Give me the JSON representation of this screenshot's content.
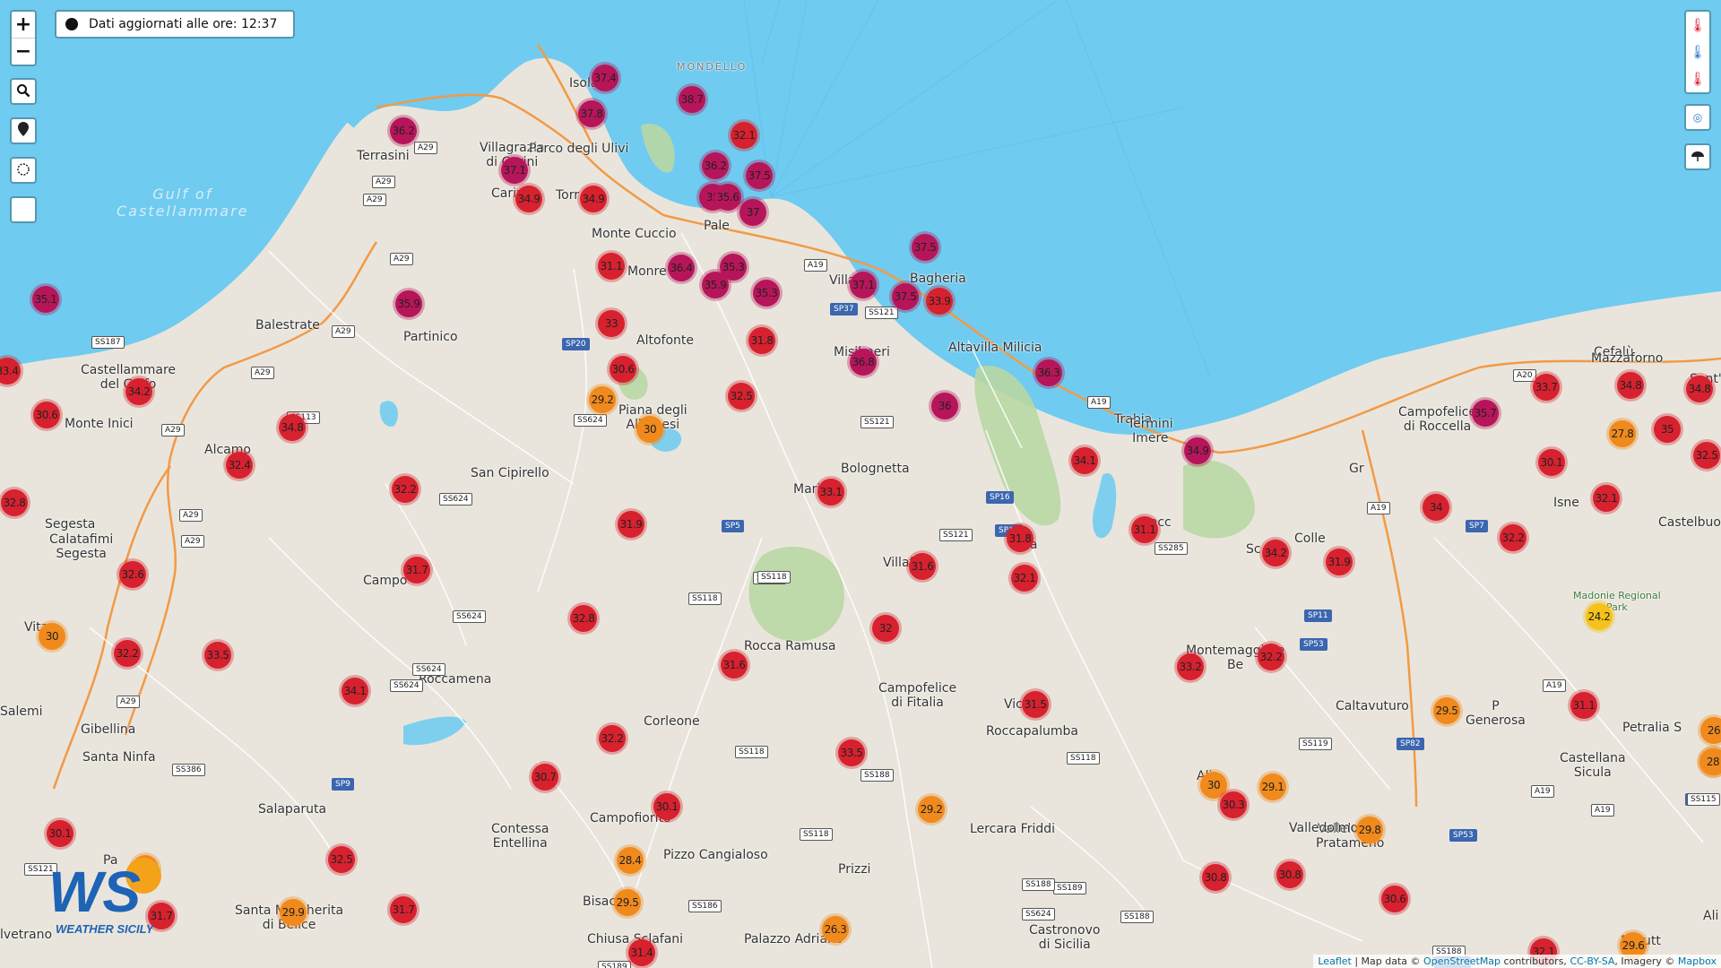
{
  "info_box": {
    "text": "Dati aggiornati alle ore: 12:37"
  },
  "controls": {
    "zoom_in": "+",
    "zoom_out": "−"
  },
  "colors": {
    "sea": "#6fcbf0",
    "land": "#e9e5dc",
    "highway": "#f29a46",
    "red": "#d7212e",
    "magenta": "#b7155a",
    "orange": "#f08a1c",
    "yellow": "#f4c21a"
  },
  "sea_labels": [
    {
      "name": "Gulf of\nCastellammare"
    }
  ],
  "places": [
    {
      "name": "MONDELLO"
    },
    {
      "name": "Terrasini"
    },
    {
      "name": "Villagrazia\ndi Carini"
    },
    {
      "name": "Parco degli Ulivi"
    },
    {
      "name": "Carini"
    },
    {
      "name": "Torr"
    },
    {
      "name": "Monte Cuccio"
    },
    {
      "name": "Pale"
    },
    {
      "name": "Monre"
    },
    {
      "name": "Isola"
    },
    {
      "name": "Villa"
    },
    {
      "name": "Bagheria"
    },
    {
      "name": "Altavilla Milicia"
    },
    {
      "name": "Misilmeri"
    },
    {
      "name": "Altofonte"
    },
    {
      "name": "Piana degli\nAlbanesi"
    },
    {
      "name": "Balestrate"
    },
    {
      "name": "Partinico"
    },
    {
      "name": "Castellammare\ndel Golfo"
    },
    {
      "name": "Monte Inici"
    },
    {
      "name": "Alcamo"
    },
    {
      "name": "San Cipirello"
    },
    {
      "name": "Bolognetta"
    },
    {
      "name": "Mari"
    },
    {
      "name": "Trabia"
    },
    {
      "name": "Termini\nImere"
    },
    {
      "name": "Campofelice\ndi Roccella"
    },
    {
      "name": "Cefalù"
    },
    {
      "name": "Mazzaforno"
    },
    {
      "name": "Sant'Ambrog"
    },
    {
      "name": "Segesta"
    },
    {
      "name": "Calatafimi\nSegesta"
    },
    {
      "name": "Campo"
    },
    {
      "name": "Villaf"
    },
    {
      "name": "Cacc"
    },
    {
      "name": "Sc"
    },
    {
      "name": "Isne"
    },
    {
      "name": "Colle"
    },
    {
      "name": "Castelbuon"
    },
    {
      "name": "Madonie Regional\nPark"
    },
    {
      "name": "Vita"
    },
    {
      "name": "Salemi"
    },
    {
      "name": "Roccamena"
    },
    {
      "name": "Rocca Ramusa"
    },
    {
      "name": "Corleone"
    },
    {
      "name": "Campofelice\ndi Fitalia"
    },
    {
      "name": "Vica"
    },
    {
      "name": "Roccapalumba"
    },
    {
      "name": "Montemaggiore\nBe"
    },
    {
      "name": "Caltavuturo"
    },
    {
      "name": "Petralia S"
    },
    {
      "name": "P\nGenerosa"
    },
    {
      "name": "Castellana\nSicula"
    },
    {
      "name": "Gibellina"
    },
    {
      "name": "Santa Ninfa"
    },
    {
      "name": "Salaparuta"
    },
    {
      "name": "Contessa\nEntellina"
    },
    {
      "name": "Campofiorito"
    },
    {
      "name": "Pizzo Cangialoso"
    },
    {
      "name": "Prizzi"
    },
    {
      "name": "Lercara Friddi"
    },
    {
      "name": "Alia"
    },
    {
      "name": "Vallelunga\nPratameno"
    },
    {
      "name": "Valledolmo"
    },
    {
      "name": "Pa"
    },
    {
      "name": "Santa Margherita\ndi Belice"
    },
    {
      "name": "lvetrano"
    },
    {
      "name": "Bisac"
    },
    {
      "name": "Chiusa Sclafani"
    },
    {
      "name": "Palazzo Adriano"
    },
    {
      "name": "Castronovo\ndi Sicilia"
    },
    {
      "name": "Resutt"
    },
    {
      "name": "Ali"
    },
    {
      "name": "Gr"
    },
    {
      "name": "Sa"
    }
  ],
  "roads": [
    "A29",
    "A29",
    "A29",
    "A29",
    "A29",
    "A29",
    "A29",
    "A29",
    "A29",
    "A29",
    "A19",
    "A19",
    "A19",
    "A19",
    "A19",
    "A19",
    "A20",
    "SS187",
    "SS113",
    "SP20",
    "SS624",
    "SS624",
    "SS624",
    "SS624",
    "SS624",
    "SS121",
    "SS121",
    "SS121",
    "SP37",
    "SP16",
    "SP16",
    "SS285",
    "SP5",
    "SS118",
    "SS118",
    "SS118",
    "SS118",
    "SS118",
    "SS118",
    "SS189",
    "SS188",
    "SS188",
    "SS189",
    "SS186",
    "SS386",
    "SS188",
    "SS119",
    "SP82",
    "SP53",
    "SP53",
    "SP7",
    "SP8",
    "SP9",
    "SS624",
    "SS188",
    "SP26-D",
    "SS121",
    "SS115",
    "SP11",
    "SP7"
  ],
  "stations": [
    {
      "v": "37.4",
      "c": "magenta"
    },
    {
      "v": "38.7",
      "c": "magenta"
    },
    {
      "v": "37.8",
      "c": "magenta"
    },
    {
      "v": "36.2",
      "c": "magenta"
    },
    {
      "v": "32.1",
      "c": "red"
    },
    {
      "v": "36.2",
      "c": "magenta"
    },
    {
      "v": "37.5",
      "c": "magenta"
    },
    {
      "v": "37.1",
      "c": "magenta"
    },
    {
      "v": "34.9",
      "c": "red"
    },
    {
      "v": "34.9",
      "c": "red"
    },
    {
      "v": "35",
      "c": "magenta"
    },
    {
      "v": "35.6",
      "c": "magenta"
    },
    {
      "v": "37",
      "c": "magenta"
    },
    {
      "v": "31.1",
      "c": "red"
    },
    {
      "v": "36.4",
      "c": "magenta"
    },
    {
      "v": "35.3",
      "c": "magenta"
    },
    {
      "v": "35.9",
      "c": "magenta"
    },
    {
      "v": "35.3",
      "c": "magenta"
    },
    {
      "v": "37.1",
      "c": "magenta"
    },
    {
      "v": "37.5",
      "c": "magenta"
    },
    {
      "v": "33.9",
      "c": "red"
    },
    {
      "v": "35.1",
      "c": "magenta"
    },
    {
      "v": "35.9",
      "c": "magenta"
    },
    {
      "v": "33",
      "c": "red"
    },
    {
      "v": "31.8",
      "c": "red"
    },
    {
      "v": "36.8",
      "c": "magenta"
    },
    {
      "v": "36.3",
      "c": "magenta"
    },
    {
      "v": "33.4",
      "c": "red"
    },
    {
      "v": "34.2",
      "c": "red"
    },
    {
      "v": "30.6",
      "c": "red"
    },
    {
      "v": "30.6",
      "c": "red"
    },
    {
      "v": "29.2",
      "c": "orange"
    },
    {
      "v": "30",
      "c": "orange"
    },
    {
      "v": "32.5",
      "c": "red"
    },
    {
      "v": "36",
      "c": "magenta"
    },
    {
      "v": "34.8",
      "c": "red"
    },
    {
      "v": "32.4",
      "c": "red"
    },
    {
      "v": "34.1",
      "c": "red"
    },
    {
      "v": "34.9",
      "c": "magenta"
    },
    {
      "v": "32.8",
      "c": "red"
    },
    {
      "v": "32.2",
      "c": "red"
    },
    {
      "v": "31.9",
      "c": "red"
    },
    {
      "v": "33.1",
      "c": "red"
    },
    {
      "v": "31.8",
      "c": "red"
    },
    {
      "v": "31.1",
      "c": "red"
    },
    {
      "v": "31.6",
      "c": "red"
    },
    {
      "v": "32.1",
      "c": "red"
    },
    {
      "v": "34.2",
      "c": "red"
    },
    {
      "v": "31.9",
      "c": "red"
    },
    {
      "v": "32.6",
      "c": "red"
    },
    {
      "v": "31.7",
      "c": "red"
    },
    {
      "v": "30",
      "c": "orange"
    },
    {
      "v": "32.8",
      "c": "red"
    },
    {
      "v": "32",
      "c": "red"
    },
    {
      "v": "32.2",
      "c": "red"
    },
    {
      "v": "33.5",
      "c": "red"
    },
    {
      "v": "31.6",
      "c": "red"
    },
    {
      "v": "34.1",
      "c": "red"
    },
    {
      "v": "33.2",
      "c": "red"
    },
    {
      "v": "32.2",
      "c": "red"
    },
    {
      "v": "31.5",
      "c": "red"
    },
    {
      "v": "32.2",
      "c": "red"
    },
    {
      "v": "33.5",
      "c": "red"
    },
    {
      "v": "30.7",
      "c": "red"
    },
    {
      "v": "30.1",
      "c": "red"
    },
    {
      "v": "29.2",
      "c": "orange"
    },
    {
      "v": "30",
      "c": "orange"
    },
    {
      "v": "29.1",
      "c": "orange"
    },
    {
      "v": "30.3",
      "c": "red"
    },
    {
      "v": "29.8",
      "c": "orange"
    },
    {
      "v": "30.1",
      "c": "red"
    },
    {
      "v": "28.4",
      "c": "orange"
    },
    {
      "v": "32.5",
      "c": "red"
    },
    {
      "v": "31.7",
      "c": "red"
    },
    {
      "v": "29.9",
      "c": "orange"
    },
    {
      "v": "29.5",
      "c": "orange"
    },
    {
      "v": "31.4",
      "c": "red"
    },
    {
      "v": "26.3",
      "c": "orange"
    },
    {
      "v": "30.8",
      "c": "red"
    },
    {
      "v": "30.8",
      "c": "red"
    },
    {
      "v": "30.6",
      "c": "red"
    },
    {
      "v": "29.5",
      "c": "orange"
    },
    {
      "v": "31.1",
      "c": "red"
    },
    {
      "v": "34",
      "c": "red"
    },
    {
      "v": "32.2",
      "c": "red"
    },
    {
      "v": "30.1",
      "c": "red"
    },
    {
      "v": "32.1",
      "c": "red"
    },
    {
      "v": "33.7",
      "c": "red"
    },
    {
      "v": "34.8",
      "c": "red"
    },
    {
      "v": "35.7",
      "c": "magenta"
    },
    {
      "v": "27.8",
      "c": "orange"
    },
    {
      "v": "35",
      "c": "red"
    },
    {
      "v": "32.5",
      "c": "red"
    },
    {
      "v": "34.8",
      "c": "red"
    },
    {
      "v": "24.2",
      "c": "yellow"
    },
    {
      "v": "29.6",
      "c": "orange"
    },
    {
      "v": "28",
      "c": "orange"
    },
    {
      "v": "26",
      "c": "orange"
    },
    {
      "v": "31.7",
      "c": "red"
    },
    {
      "v": "28",
      "c": "orange"
    },
    {
      "v": "29",
      "c": "orange"
    },
    {
      "v": "32.1",
      "c": "red"
    },
    {
      "v": "37.5",
      "c": "magenta"
    }
  ],
  "attribution": {
    "leaflet": "Leaflet",
    "sep": " | Map data © ",
    "osm": "OpenStreetMap",
    "mid": " contributors, ",
    "ccbysa": "CC-BY-SA",
    "imagery": ", Imagery © ",
    "mapbox": "Mapbox"
  },
  "logo": {
    "text": "WEATHER SICILY",
    "mark": "WS"
  }
}
